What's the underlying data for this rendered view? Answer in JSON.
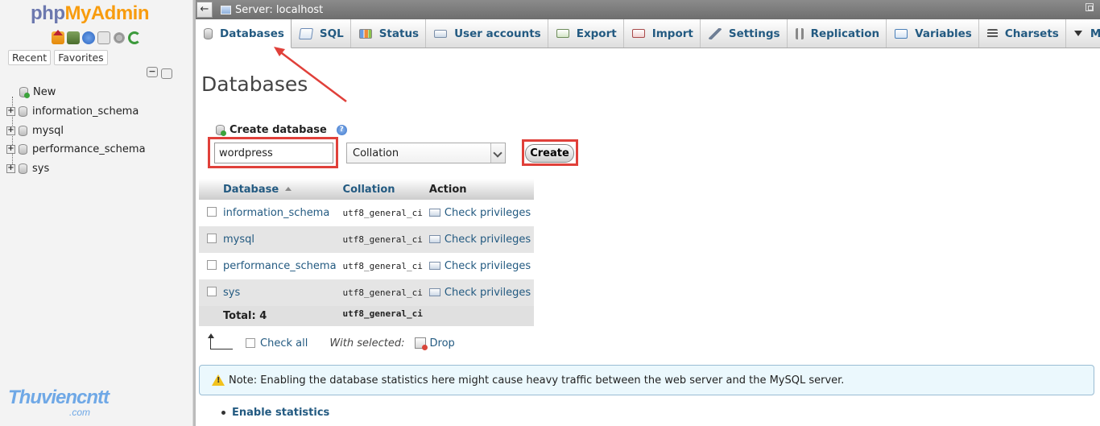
{
  "app": {
    "logo_php": "php",
    "logo_myadmin": "MyAdmin"
  },
  "sidebar": {
    "tabs": [
      "Recent",
      "Favorites"
    ],
    "tree": [
      {
        "label": "New"
      },
      {
        "label": "information_schema"
      },
      {
        "label": "mysql"
      },
      {
        "label": "performance_schema"
      },
      {
        "label": "sys"
      }
    ],
    "watermark": "Thuviencntt",
    "watermark_sub": ".com"
  },
  "serverbar": {
    "label": "Server: localhost"
  },
  "tabs": [
    {
      "label": "Databases",
      "icon": "database-icon",
      "active": true
    },
    {
      "label": "SQL",
      "icon": "sql-icon"
    },
    {
      "label": "Status",
      "icon": "status-icon"
    },
    {
      "label": "User accounts",
      "icon": "users-icon"
    },
    {
      "label": "Export",
      "icon": "export-icon"
    },
    {
      "label": "Import",
      "icon": "import-icon"
    },
    {
      "label": "Settings",
      "icon": "wrench-icon"
    },
    {
      "label": "Replication",
      "icon": "replication-icon"
    },
    {
      "label": "Variables",
      "icon": "variables-icon"
    },
    {
      "label": "Charsets",
      "icon": "charsets-icon"
    },
    {
      "label": "More",
      "icon": "caret-down-icon"
    }
  ],
  "main": {
    "title": "Databases",
    "create_label": "Create database",
    "db_name_value": "wordpress",
    "collation_value": "Collation",
    "create_button": "Create",
    "table": {
      "headers": [
        "Database",
        "Collation",
        "Action"
      ],
      "rows": [
        {
          "name": "information_schema",
          "collation": "utf8_general_ci",
          "action": "Check privileges"
        },
        {
          "name": "mysql",
          "collation": "utf8_general_ci",
          "action": "Check privileges"
        },
        {
          "name": "performance_schema",
          "collation": "utf8_general_ci",
          "action": "Check privileges"
        },
        {
          "name": "sys",
          "collation": "utf8_general_ci",
          "action": "Check privileges"
        }
      ],
      "total_label": "Total: 4",
      "total_collation": "utf8_general_ci"
    },
    "bulk": {
      "check_all": "Check all",
      "with_selected": "With selected:",
      "drop": "Drop"
    },
    "notice": "Note: Enabling the database statistics here might cause heavy traffic between the web server and the MySQL server.",
    "enable_stats": "Enable statistics"
  },
  "colors": {
    "link": "#235a81",
    "highlight": "#e0403a",
    "logo_php": "#6c78af",
    "logo_myadmin": "#f89c0e"
  }
}
